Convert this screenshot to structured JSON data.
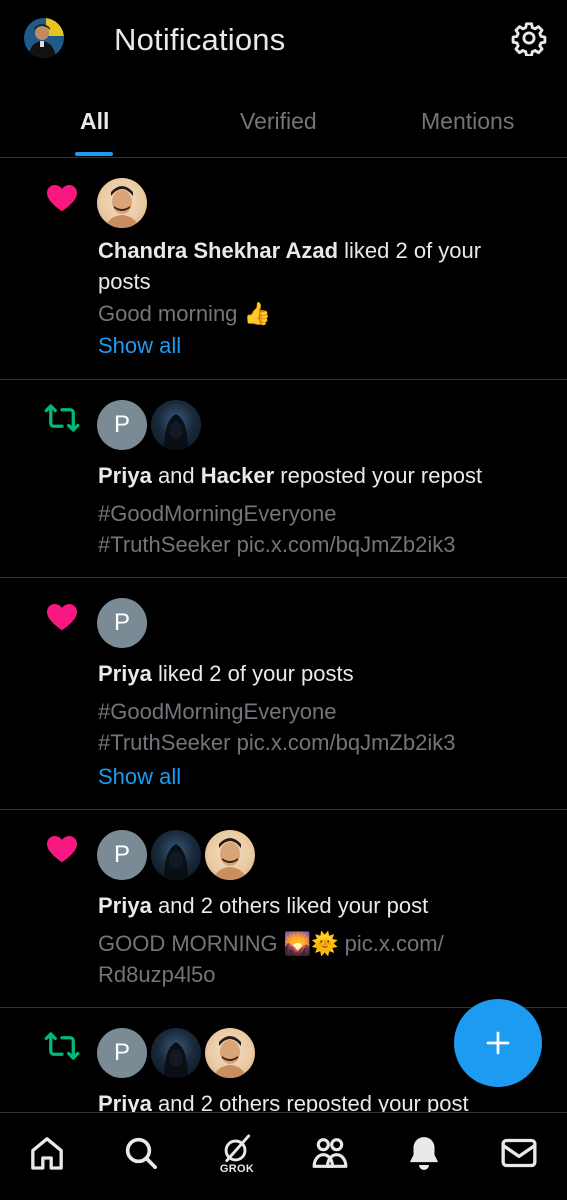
{
  "header": {
    "title": "Notifications"
  },
  "tabs": [
    {
      "label": "All",
      "active": true
    },
    {
      "label": "Verified",
      "active": false
    },
    {
      "label": "Mentions",
      "active": false
    }
  ],
  "notifications": [
    {
      "type": "like",
      "actor1": "Chandra Shekhar Azad",
      "action": " liked 2 of your posts",
      "preview": "Good morning 👍",
      "link": "Show all"
    },
    {
      "type": "repost",
      "actor1": "Priya",
      "joiner": " and ",
      "actor2": "Hacker",
      "action": " reposted your repost",
      "preview_line1": "#GoodMorningEveryone",
      "preview_line2": "#TruthSeeker pic.x.com/bqJmZb2ik3"
    },
    {
      "type": "like",
      "actor1": "Priya",
      "action": " liked 2 of your posts",
      "preview_line1": "#GoodMorningEveryone",
      "preview_line2": "#TruthSeeker pic.x.com/bqJmZb2ik3",
      "link": "Show all"
    },
    {
      "type": "like",
      "actor1": "Priya",
      "action": " and 2 others liked your post",
      "preview_line1": "GOOD MORNING 🌄🌞 pic.x.com/",
      "preview_line2": "Rd8uzp4l5o"
    },
    {
      "type": "repost",
      "actor1": "Priya",
      "action": " and 2 others reposted your post"
    }
  ],
  "avatar_letter": "P",
  "bottom_nav": {
    "grok_label": "GROK"
  },
  "colors": {
    "accent": "#1d9bf0",
    "like": "#f91880",
    "repost": "#00ba7c",
    "background": "#000000",
    "muted_text": "#71767b"
  }
}
